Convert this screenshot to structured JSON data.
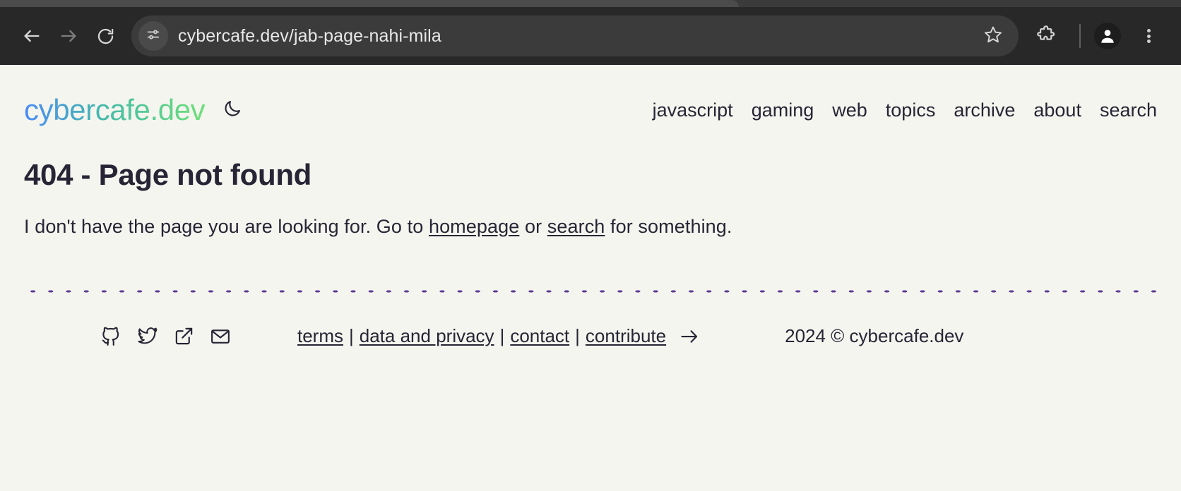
{
  "browser": {
    "back_icon": "arrow-left-icon",
    "forward_icon": "arrow-right-icon",
    "reload_icon": "reload-icon",
    "site_info_icon": "tune-settings-icon",
    "url": "cybercafe.dev/jab-page-nahi-mila",
    "url_placeholder": "Search Google or type a URL",
    "bookmark_icon": "star-icon",
    "extensions_icon": "puzzle-piece-icon",
    "profile_icon": "account-avatar-icon",
    "menu_icon": "three-dots-vertical-icon",
    "toolbar_bg": "#282828",
    "omnibox_bg": "#3b3b3b"
  },
  "site": {
    "brand": "cybercafe.dev",
    "brand_gradient_from": "#4a8cf7",
    "brand_gradient_to": "#6ee07a",
    "theme_toggle_icon": "moon-icon",
    "nav": [
      {
        "label": "javascript"
      },
      {
        "label": "gaming"
      },
      {
        "label": "web"
      },
      {
        "label": "topics"
      },
      {
        "label": "archive"
      },
      {
        "label": "about"
      },
      {
        "label": "search"
      }
    ]
  },
  "main": {
    "heading": "404 - Page not found",
    "paragraph": {
      "before": "I don't have the page you are looking for. Go to ",
      "link_homepage": "homepage",
      "middle": " or ",
      "link_search": "search",
      "after": " for something."
    },
    "divider_color": "#5e3a95"
  },
  "footer": {
    "social": [
      {
        "name": "github-icon"
      },
      {
        "name": "twitter-icon"
      },
      {
        "name": "external-link-icon"
      },
      {
        "name": "mail-icon"
      }
    ],
    "links": [
      {
        "label": "terms"
      },
      {
        "label": "data and privacy"
      },
      {
        "label": "contact"
      },
      {
        "label": "contribute"
      }
    ],
    "separator": "|",
    "arrow_icon": "arrow-right-icon",
    "copyright": "2024 © cybercafe.dev"
  },
  "theme": {
    "page_bg": "#f5f5ef",
    "text": "#272535"
  }
}
